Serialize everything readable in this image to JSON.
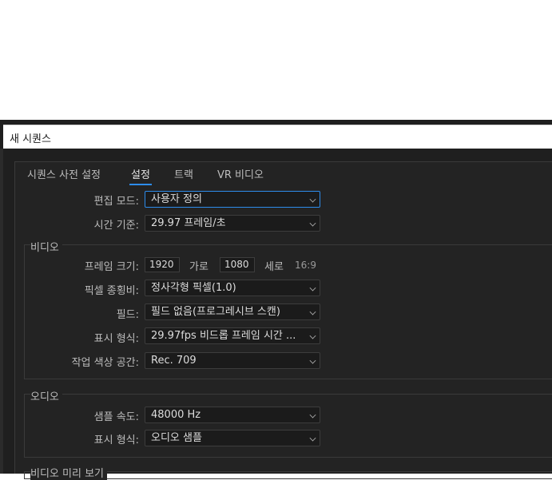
{
  "dialog": {
    "title": "새 시퀀스"
  },
  "tabs": [
    {
      "label": "시퀀스 사전 설정"
    },
    {
      "label": "설정"
    },
    {
      "label": "트랙"
    },
    {
      "label": "VR 비디오"
    }
  ],
  "general": {
    "edit_mode_label": "편집 모드:",
    "edit_mode_value": "사용자 정의",
    "timebase_label": "시간 기준:",
    "timebase_value": "29.97 프레임/초"
  },
  "video": {
    "section_title": "비디오",
    "frame_size_label": "프레임 크기:",
    "frame_width": "1920",
    "horizontal_label": "가로",
    "frame_height": "1080",
    "vertical_label": "세로",
    "aspect": "16:9",
    "pixel_aspect_label": "픽셀 종횡비:",
    "pixel_aspect_value": "정사각형 픽셀(1.0)",
    "fields_label": "필드:",
    "fields_value": "필드 없음(프로그레시브 스캔)",
    "display_format_label": "표시 형식:",
    "display_format_value": "29.97fps 비드롭 프레임 시간 ...",
    "color_space_label": "작업 색상 공간:",
    "color_space_value": "Rec. 709"
  },
  "audio": {
    "section_title": "오디오",
    "sample_rate_label": "샘플 속도:",
    "sample_rate_value": "48000 Hz",
    "display_format_label": "표시 형식:",
    "display_format_value": "오디오 샘플"
  },
  "preview": {
    "section_title": "비디오 미리 보기"
  }
}
